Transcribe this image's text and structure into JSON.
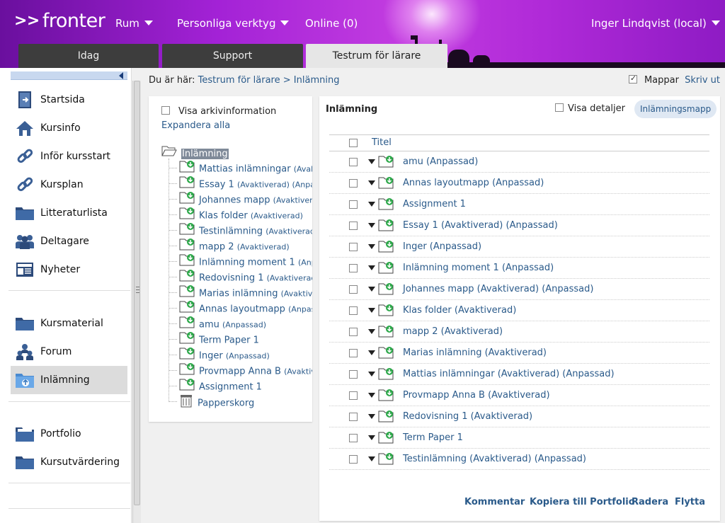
{
  "brand": {
    "logo_arrows": ">>",
    "logo_text": "fronter"
  },
  "topnav": {
    "rum": "Rum",
    "verktyg": "Personliga verktyg",
    "online": "Online (0)",
    "user": "Inger Lindqvist (local)"
  },
  "tabs": [
    {
      "label": "Idag"
    },
    {
      "label": "Support"
    },
    {
      "label": "Testrum för lärare"
    }
  ],
  "sidebar": {
    "items": [
      {
        "label": "Startsida",
        "icon": "door-icon"
      },
      {
        "label": "Kursinfo",
        "icon": "house-icon"
      },
      {
        "label": "Inför kursstart",
        "icon": "link-icon"
      },
      {
        "label": "Kursplan",
        "icon": "link-icon"
      },
      {
        "label": "Litteraturlista",
        "icon": "folder-icon"
      },
      {
        "label": "Deltagare",
        "icon": "people-icon"
      },
      {
        "label": "Nyheter",
        "icon": "news-icon"
      },
      {
        "label": "Kursmaterial",
        "icon": "folder-icon"
      },
      {
        "label": "Forum",
        "icon": "forum-icon"
      },
      {
        "label": "Inlämning",
        "icon": "upload-folder-icon"
      },
      {
        "label": "Portfolio",
        "icon": "portfolio-icon"
      },
      {
        "label": "Kursutvärdering",
        "icon": "folder-icon"
      }
    ]
  },
  "breadcrumb": {
    "prefix": "Du är här:",
    "room": "Testrum för lärare",
    "sep": ">",
    "current": "Inlämning",
    "mappar": "Mappar",
    "print": "Skriv ut"
  },
  "tree": {
    "archive_label": "Visa arkivinformation",
    "expand_all": "Expandera alla",
    "root": "Inlämning",
    "nodes": [
      {
        "name": "Mattias inlämningar",
        "tag": "(Avaktiverad)"
      },
      {
        "name": "Essay 1",
        "tag": "(Avaktiverad) (Anpassad)"
      },
      {
        "name": "Johannes mapp",
        "tag": "(Avaktiverad)"
      },
      {
        "name": "Klas folder",
        "tag": "(Avaktiverad)"
      },
      {
        "name": "Testinlämning",
        "tag": "(Avaktiverad)"
      },
      {
        "name": "mapp 2",
        "tag": "(Avaktiverad)"
      },
      {
        "name": "Inlämning moment 1",
        "tag": "(Anpassad)"
      },
      {
        "name": "Redovisning 1",
        "tag": "(Avaktiverad)"
      },
      {
        "name": "Marias inlämning",
        "tag": "(Avaktiverad)"
      },
      {
        "name": "Annas layoutmapp",
        "tag": "(Anpassad)"
      },
      {
        "name": "amu",
        "tag": "(Anpassad)"
      },
      {
        "name": "Term Paper 1",
        "tag": ""
      },
      {
        "name": "Inger",
        "tag": "(Anpassad)"
      },
      {
        "name": "Provmapp Anna B",
        "tag": "(Avaktiverad)"
      },
      {
        "name": "Assignment 1",
        "tag": ""
      }
    ],
    "trash": "Papperskorg"
  },
  "main": {
    "title": "Inlämning",
    "details_label": "Visa detaljer",
    "folder_button": "Inlämningsmapp",
    "column_title": "Titel",
    "rows": [
      "amu (Anpassad)",
      "Annas layoutmapp (Anpassad)",
      "Assignment 1",
      "Essay 1 (Avaktiverad) (Anpassad)",
      "Inger (Anpassad)",
      "Inlämning moment 1 (Anpassad)",
      "Johannes mapp (Avaktiverad) (Anpassad)",
      "Klas folder (Avaktiverad)",
      "mapp 2 (Avaktiverad)",
      "Marias inlämning (Avaktiverad)",
      "Mattias inlämningar (Avaktiverad) (Anpassad)",
      "Provmapp Anna B (Avaktiverad)",
      "Redovisning 1 (Avaktiverad)",
      "Term Paper 1",
      "Testinlämning (Avaktiverad) (Anpassad)"
    ],
    "actions": [
      "Kommentar",
      "Kopiera till Portfolio",
      "Radera",
      "Flytta"
    ]
  },
  "colors": {
    "header": "#a322d6",
    "link": "#2a5a8a",
    "tab_dark": "#3d3d3d",
    "tab_active": "#e6e6e6",
    "folder_green": "#2da84a"
  }
}
